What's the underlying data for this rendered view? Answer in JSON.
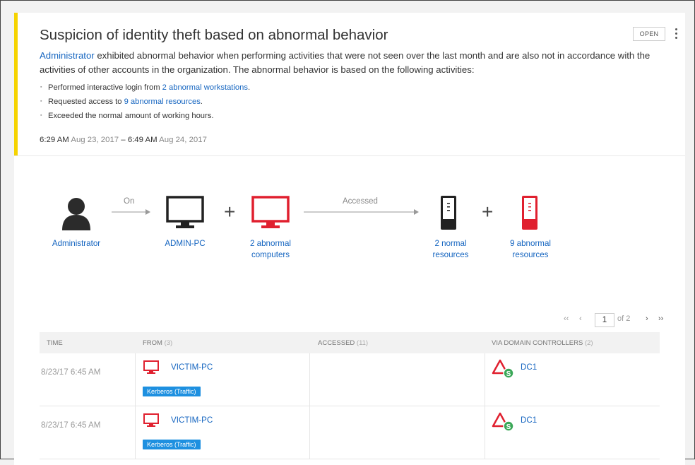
{
  "alert": {
    "title": "Suspicion of identity theft based on abnormal behavior",
    "status": "OPEN",
    "description": {
      "account": "Administrator",
      "text": " exhibited abnormal behavior when performing activities that were not seen over the last month and are also not in accordance with the activities of other accounts in the organization. The abnormal behavior is based on the following activities:"
    },
    "bullets": [
      {
        "prefix": "Performed interactive login from ",
        "link": "2 abnormal workstations",
        "suffix": "."
      },
      {
        "prefix": "Requested access to ",
        "link": "9 abnormal resources",
        "suffix": "."
      },
      {
        "prefix": "Exceeded the normal amount of working hours.",
        "link": "",
        "suffix": ""
      }
    ],
    "time_range": {
      "start_time": "6:29 AM",
      "start_date": "Aug 23, 2017",
      "separator": "–",
      "end_time": "6:49 AM",
      "end_date": "Aug 24, 2017"
    }
  },
  "diagram": {
    "user_label": "Administrator",
    "arrow1_label": "On",
    "computer_label": "ADMIN-PC",
    "plus1": "+",
    "abnormal_computers_line1": "2 abnormal",
    "abnormal_computers_line2": "computers",
    "arrow2_label": "Accessed",
    "normal_resources_line1": "2 normal",
    "normal_resources_line2": "resources",
    "plus2": "+",
    "abnormal_resources_line1": "9 abnormal",
    "abnormal_resources_line2": "resources",
    "colors": {
      "normal": "#222222",
      "abnormal": "#e0202f"
    }
  },
  "pager": {
    "first": "‹‹",
    "prev": "‹",
    "page": "1",
    "of": "of 2",
    "next": "›",
    "last": "››"
  },
  "table": {
    "columns": [
      {
        "label": "TIME",
        "count": ""
      },
      {
        "label": "FROM",
        "count": "(3)"
      },
      {
        "label": "ACCESSED",
        "count": "(11)"
      },
      {
        "label": "VIA DOMAIN CONTROLLERS",
        "count": "(2)"
      }
    ],
    "rows": [
      {
        "time": "8/23/17 6:45 AM",
        "from": "VICTIM-PC",
        "protocol": "Kerberos (Traffic)",
        "accessed": "",
        "dc": "DC1",
        "dc_badge": "S"
      },
      {
        "time": "8/23/17 6:45 AM",
        "from": "VICTIM-PC",
        "protocol": "Kerberos (Traffic)",
        "accessed": "",
        "dc": "DC1",
        "dc_badge": "S"
      }
    ]
  }
}
